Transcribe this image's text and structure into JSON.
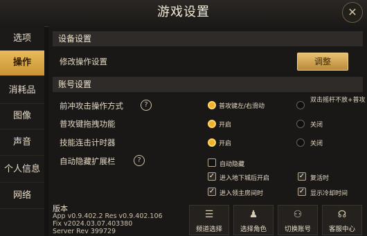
{
  "window": {
    "title": "游戏设置"
  },
  "sidebar": {
    "items": [
      {
        "label": "选项"
      },
      {
        "label": "操作"
      },
      {
        "label": "消耗品"
      },
      {
        "label": "图像"
      },
      {
        "label": "声音"
      },
      {
        "label": "个人信息"
      },
      {
        "label": "网络"
      }
    ],
    "active_index": 1
  },
  "device_settings": {
    "header": "设备设置",
    "modify_label": "修改操作设置",
    "adjust_button": "调整"
  },
  "account_settings": {
    "header": "账号设置",
    "rows": [
      {
        "label": "前冲攻击操作方式",
        "option_on": "普攻键左/右滑动",
        "option_off": "双击摇杆不放+普攻"
      },
      {
        "label": "普攻键拖拽功能",
        "option_on": "开启",
        "option_off": "关闭"
      },
      {
        "label": "技能连击计时器",
        "option_on": "开启",
        "option_off": "关闭"
      }
    ],
    "autohide": {
      "label": "自动隐藏扩展栏",
      "checkboxes": [
        {
          "label": "自动隐藏",
          "checked": false
        },
        {
          "label": "进入地下城后开启",
          "checked": true
        },
        {
          "label": "复活时",
          "checked": true
        },
        {
          "label": "进入领主房间时",
          "checked": true
        },
        {
          "label": "显示冷却时间",
          "checked": true
        }
      ]
    }
  },
  "version": {
    "title": "版本",
    "line1": "App v0.9.402.2 Res v0.9.402.106",
    "line2": "Fix v2024.03.07.403380",
    "line3": "Server Rev 399729"
  },
  "bottom_buttons": [
    {
      "label": "频道选择",
      "icon": "list-icon"
    },
    {
      "label": "选择角色",
      "icon": "character-icon"
    },
    {
      "label": "切换账号",
      "icon": "users-icon"
    },
    {
      "label": "客服中心",
      "icon": "headset-icon"
    }
  ],
  "colors": {
    "accent": "#e9bb5a",
    "radio_on": "#f0b22a"
  }
}
